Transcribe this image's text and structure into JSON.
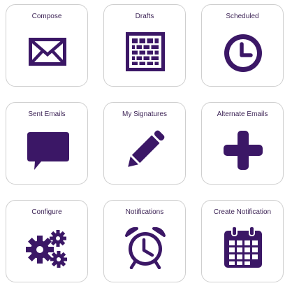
{
  "colors": {
    "accent": "#3b1766",
    "tile_border": "#cfcfcf",
    "label": "#3d2456"
  },
  "tiles": [
    {
      "label": "Compose",
      "icon": "envelope-icon"
    },
    {
      "label": "Drafts",
      "icon": "brick-wall-icon"
    },
    {
      "label": "Scheduled",
      "icon": "clock-icon"
    },
    {
      "label": "Sent Emails",
      "icon": "speech-bubble-icon"
    },
    {
      "label": "My Signatures",
      "icon": "pencil-icon"
    },
    {
      "label": "Alternate Emails",
      "icon": "plus-icon"
    },
    {
      "label": "Configure",
      "icon": "gears-icon"
    },
    {
      "label": "Notifications",
      "icon": "alarm-clock-icon"
    },
    {
      "label": "Create Notification",
      "icon": "calendar-icon"
    }
  ]
}
